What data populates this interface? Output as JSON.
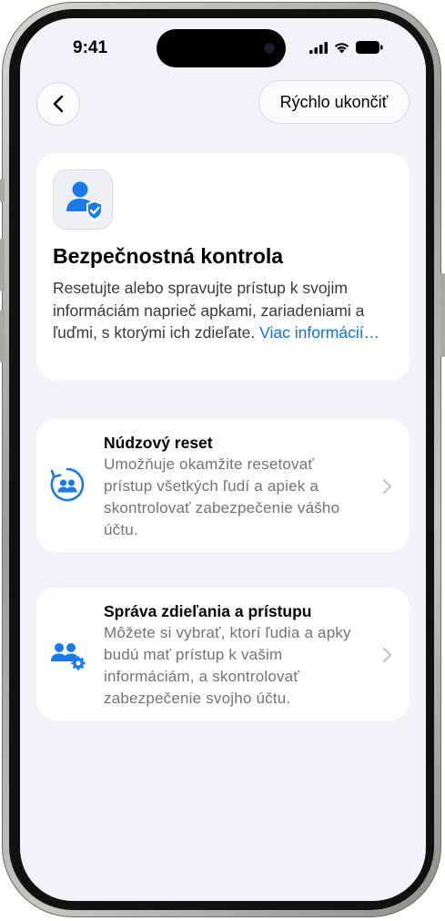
{
  "status_bar": {
    "time": "9:41"
  },
  "nav": {
    "quick_exit_label": "Rýchlo ukončiť"
  },
  "header": {
    "title": "Bezpečnostná kontrola",
    "description": "Resetujte alebo spravujte prístup k svojim informáciám naprieč apkami, zariadeniami a ľuďmi, s ktorými ich zdieľate.",
    "link": "Viac informácií…"
  },
  "options": [
    {
      "title": "Núdzový reset",
      "description": "Umožňuje okamžite resetovať prístup všetkých ľudí a apiek a skontrolovať zabezpečenie vášho účtu.",
      "icon": "emergency-reset-icon"
    },
    {
      "title": "Správa zdieľania a prístupu",
      "description": "Môžete si vybrať, ktorí ľudia a apky budú mať prístup k vašim informáciám, a skontrolovať zabezpečenie svojho účtu.",
      "icon": "manage-sharing-icon"
    }
  ],
  "colors": {
    "accent": "#1a7ae8",
    "background": "#f2f2f7",
    "secondary_text": "#737378"
  }
}
